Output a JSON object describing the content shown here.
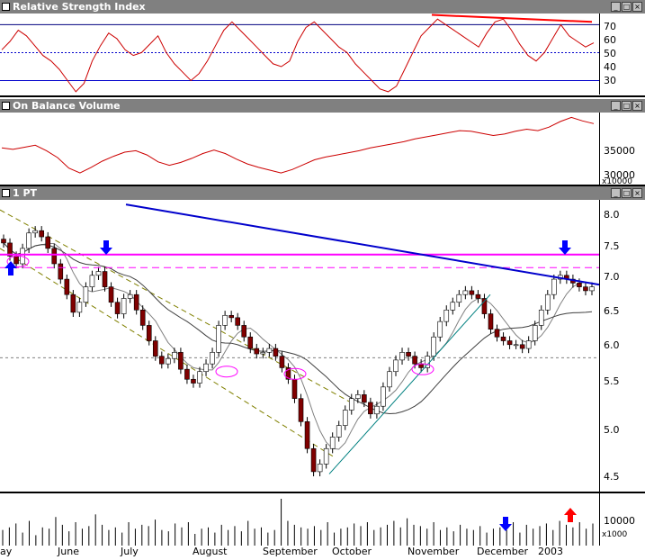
{
  "panes": {
    "rsi": {
      "title": "Relative Strength Index",
      "ticks": [
        "70",
        "60",
        "50",
        "40",
        "30"
      ]
    },
    "obv": {
      "title": "On Balance Volume",
      "ticks": [
        "35000",
        "30000"
      ],
      "unit": "x10000"
    },
    "price": {
      "title": "1 PT",
      "ticks": [
        "8.0",
        "7.5",
        "7.0",
        "6.5",
        "6.0",
        "5.5",
        "5.0",
        "4.5"
      ]
    },
    "volume": {
      "ticks": [
        "10000"
      ],
      "unit": "x1000"
    }
  },
  "months": [
    "ay",
    "June",
    "July",
    "August",
    "September",
    "October",
    "November",
    "December",
    "2003"
  ],
  "colors": {
    "rsi_line": "#cc0000",
    "obv_line": "#cc0000",
    "resistance": "#ff00ff",
    "trendline": "#0000cc",
    "channel": "#808000",
    "up_candle": "#ffffff",
    "down_candle": "#800000",
    "arrow_blue": "#0000ff",
    "arrow_red": "#ff0000",
    "ma": "#808080"
  },
  "chart_data": [
    {
      "type": "line",
      "title": "Relative Strength Index",
      "ylim": [
        20,
        78
      ],
      "reference_lines": [
        70,
        50,
        30
      ],
      "series": [
        {
          "values": [
            52,
            58,
            66,
            62,
            55,
            48,
            44,
            38,
            30,
            22,
            28,
            44,
            55,
            64,
            60,
            52,
            48,
            50,
            56,
            62,
            50,
            42,
            36,
            30,
            35,
            44,
            55,
            66,
            72,
            66,
            60,
            54,
            48,
            42,
            40,
            44,
            58,
            68,
            72,
            66,
            60,
            54,
            50,
            42,
            36,
            30,
            24,
            22,
            26,
            38,
            50,
            62,
            68,
            74,
            70,
            66,
            62,
            58,
            54,
            64,
            72,
            74,
            66,
            56,
            48,
            44,
            50,
            60,
            70,
            62,
            58,
            54,
            57
          ]
        }
      ]
    },
    {
      "type": "line",
      "title": "On Balance Volume",
      "ylim": [
        28000,
        38500
      ],
      "series": [
        {
          "values": [
            33400,
            33200,
            33500,
            33800,
            33000,
            32000,
            30500,
            29800,
            30600,
            31500,
            32200,
            32800,
            33000,
            32400,
            31400,
            30900,
            31300,
            31900,
            32600,
            33100,
            32600,
            31800,
            31100,
            30600,
            30200,
            29800,
            30300,
            31000,
            31700,
            32100,
            32400,
            32700,
            33000,
            33400,
            33700,
            34000,
            34300,
            34700,
            35000,
            35300,
            35600,
            35900,
            35800,
            35500,
            35200,
            35400,
            35800,
            36100,
            35900,
            36400,
            37200,
            37800,
            37300,
            36900
          ]
        }
      ]
    },
    {
      "type": "line",
      "title": "1 PT",
      "ylim": [
        4.38,
        8.18
      ],
      "resistance_level": 7.47,
      "support_dashed": [
        7.3,
        6.13
      ],
      "series": [
        {
          "name": "",
          "values": [
            7.62,
            7.45,
            7.35,
            7.55,
            7.75,
            7.78,
            7.7,
            7.55,
            7.35,
            7.15,
            6.95,
            6.72,
            6.85,
            7.05,
            7.2,
            7.25,
            7.05,
            6.85,
            6.7,
            6.9,
            6.95,
            6.75,
            6.55,
            6.35,
            6.15,
            6.05,
            6.12,
            6.2,
            5.98,
            5.85,
            5.8,
            5.95,
            6.05,
            6.2,
            6.55,
            6.68,
            6.65,
            6.55,
            6.4,
            6.25,
            6.18,
            6.2,
            6.25,
            6.15,
            6.0,
            5.85,
            5.6,
            5.3,
            4.95,
            4.65,
            4.75,
            4.95,
            5.1,
            5.25,
            5.45,
            5.6,
            5.65,
            5.55,
            5.4,
            5.5,
            5.75,
            5.95,
            6.1,
            6.2,
            6.15,
            6.05,
            6.0,
            6.15,
            6.4,
            6.6,
            6.75,
            6.85,
            6.95,
            7.0,
            6.95,
            6.9,
            6.7,
            6.5,
            6.4,
            6.35,
            6.3,
            6.3,
            6.25,
            6.35,
            6.55,
            6.75,
            6.95,
            7.15,
            7.2,
            7.15,
            7.1,
            7.05,
            7.0,
            7.05
          ]
        }
      ]
    },
    {
      "type": "bar",
      "title": "",
      "ylim": [
        0,
        18000
      ],
      "values": [
        6000,
        7000,
        8500,
        5000,
        9500,
        4000,
        7000,
        6500,
        11000,
        8000,
        5500,
        9000,
        6500,
        7500,
        12000,
        8000,
        6000,
        7000,
        5000,
        9000,
        6500,
        8000,
        7500,
        10000,
        6000,
        5500,
        8500,
        7000,
        9000,
        4500,
        6500,
        7000,
        5000,
        8000,
        6000,
        7500,
        5500,
        9500,
        6500,
        7000,
        5000,
        6000,
        18000,
        9500,
        8000,
        7000,
        6500,
        7500,
        6000,
        9000,
        5000,
        6500,
        7000,
        8500,
        7500,
        9000,
        6000,
        7000,
        8000,
        9500,
        7000,
        10500,
        8000,
        7500,
        6500,
        9000,
        6000,
        7000,
        5500,
        8000,
        6500,
        6000,
        7500,
        5000,
        6500,
        7000,
        6000,
        9000,
        5000,
        8000,
        6500,
        7500,
        8500,
        6000,
        9500,
        8000,
        7000,
        9000,
        6500,
        8500
      ]
    }
  ]
}
